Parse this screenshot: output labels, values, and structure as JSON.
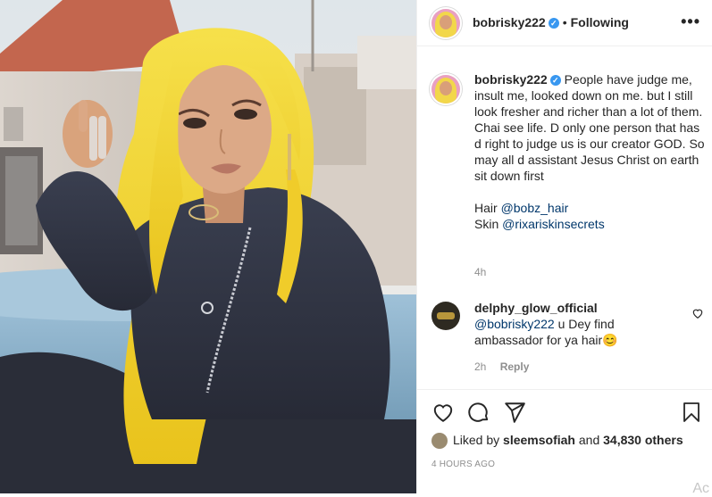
{
  "author": {
    "username": "bobrisky222",
    "verified": true,
    "follow_separator": "•",
    "follow_status": "Following"
  },
  "header": {
    "more_label": "•••"
  },
  "caption": {
    "text": "People have judge me, insult me, looked down on me. but I still look fresher and richer than a lot of them. Chai see life. D only one person that has d right to judge us is our creator GOD. So may all d assistant Jesus Christ on earth sit down first",
    "hair_label": "Hair",
    "hair_mention": "@bobz_hair",
    "skin_label": "Skin",
    "skin_mention": "@rixariskinsecrets",
    "time": "4h"
  },
  "comment": {
    "username": "delphy_glow_official",
    "mention": "@bobrisky222",
    "text": "u Dey find ambassador for ya hair😊",
    "time": "2h",
    "reply_label": "Reply"
  },
  "actions": {
    "icons": [
      "heart-icon",
      "comment-icon",
      "share-icon",
      "bookmark-icon"
    ]
  },
  "likes": {
    "prefix": "Liked by",
    "user": "sleemsofiah",
    "conj": "and",
    "others": "34,830 others"
  },
  "post_time": "4 HOURS AGO",
  "corner_text": "Ac",
  "colors": {
    "verified": "#3897f0",
    "mention": "#00376b",
    "muted": "#8e8e8e",
    "hair": "#f2d22e"
  }
}
